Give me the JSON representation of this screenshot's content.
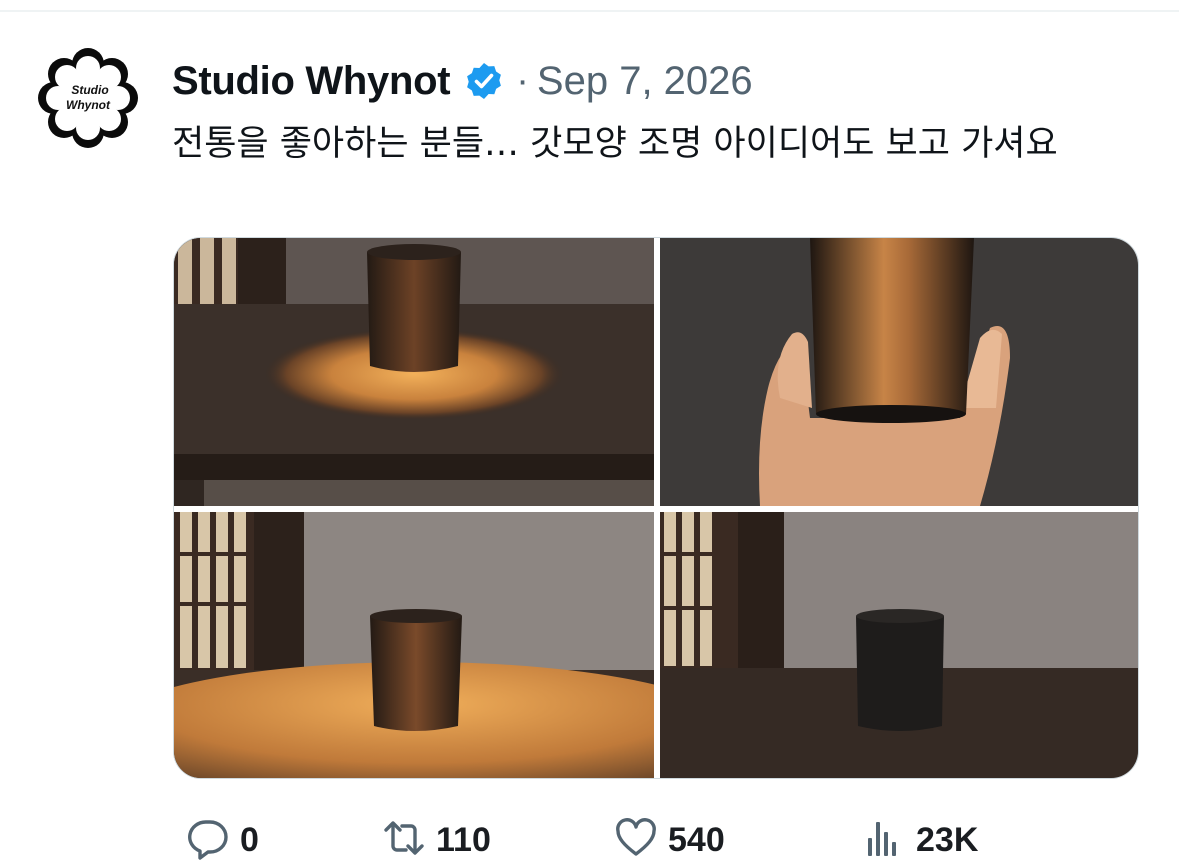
{
  "author": {
    "avatar_text_line1": "Studio",
    "avatar_text_line2": "Whynot",
    "display_name": "Studio Whynot",
    "verified_color": "#1d9bf0",
    "separator": "·",
    "date": "Sep 7, 2026"
  },
  "tweet": {
    "text": "전통을 좋아하는 분들… 갓모양 조명 아이디어도 보고 가셔요"
  },
  "media": {
    "photos": [
      {
        "id": "lamp-on-table-glowing"
      },
      {
        "id": "lamp-held-in-hand"
      },
      {
        "id": "lamp-on-table-wide-glow"
      },
      {
        "id": "lamp-off-on-table"
      }
    ]
  },
  "actions": {
    "reply": {
      "icon": "reply-icon",
      "count": "0"
    },
    "retweet": {
      "icon": "retweet-icon",
      "count": "110"
    },
    "like": {
      "icon": "heart-icon",
      "count": "540"
    },
    "views": {
      "icon": "views-icon",
      "count": "23K"
    }
  }
}
